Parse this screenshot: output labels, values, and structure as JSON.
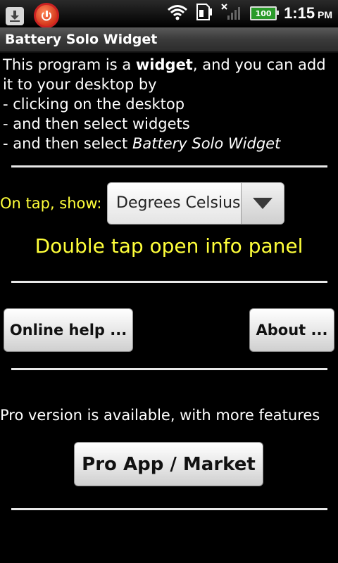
{
  "status_bar": {
    "battery_level": "100",
    "time": "1:15",
    "ampm": "PM",
    "icons": [
      "download-icon",
      "power-app-icon",
      "wifi-icon",
      "sd-card-icon",
      "no-signal-icon",
      "battery-icon"
    ]
  },
  "titlebar": {
    "title": "Battery Solo Widget"
  },
  "intro": {
    "line1_pre": " This program is a ",
    "line1_bold": "widget",
    "line1_post": ", and you can add",
    "line2": "it to your desktop by",
    "line3": " - clicking on the desktop",
    "line4": " - and then select widgets",
    "line5_pre": " - and then select ",
    "line5_italic": "Battery Solo Widget"
  },
  "settings": {
    "tap_label": "On tap, show:",
    "tap_value": "Degrees Celsius",
    "double_tap_hint": "Double tap open info panel"
  },
  "buttons": {
    "online_help": "Online help ...",
    "about": "About ...",
    "pro_market": "Pro App / Market"
  },
  "pro": {
    "text": "Pro version is available, with more features"
  },
  "colors": {
    "accent_yellow": "#ffff3a",
    "background": "#000000"
  }
}
